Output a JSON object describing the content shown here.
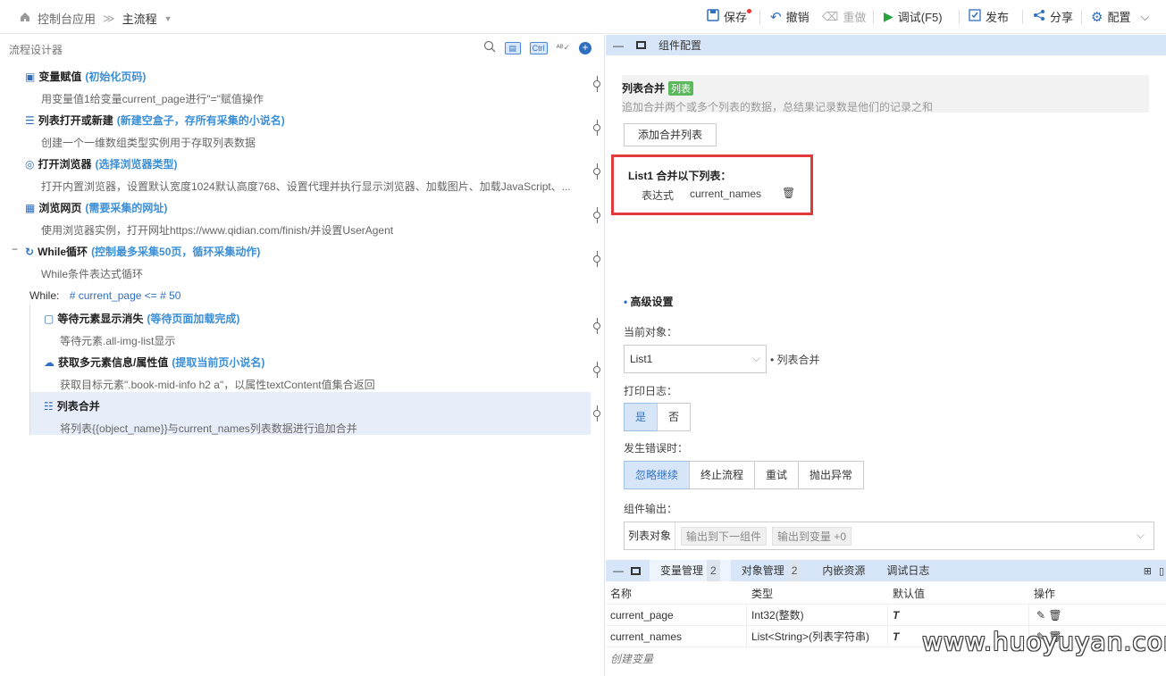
{
  "breadcrumb": {
    "app": "控制台应用",
    "flow": "主流程"
  },
  "toolbar": {
    "save": "保存",
    "undo": "撤销",
    "redo": "重做",
    "debug": "调试(F5)",
    "publish": "发布",
    "share": "分享",
    "config": "配置"
  },
  "left": {
    "title": "流程设计器",
    "ctrl": "Ctrl",
    "nodes": [
      {
        "title": "变量赋值",
        "sub": "(初始化页码)",
        "desc": "用变量值1给变量current_page进行\"=\"赋值操作"
      },
      {
        "title": "列表打开或新建",
        "sub": "(新建空盒子，存所有采集的小说名)",
        "desc": "创建一个一维数组类型实例用于存取列表数据"
      },
      {
        "title": "打开浏览器",
        "sub": "(选择浏览器类型)",
        "desc": "打开内置浏览器，设置默认宽度1024默认高度768、设置代理并执行显示浏览器、加载图片、加载JavaScript、..."
      },
      {
        "title": "浏览网页",
        "sub": "(需要采集的网址)",
        "desc": "使用浏览器实例，打开网址https://www.qidian.com/finish/并设置UserAgent"
      },
      {
        "title": "While循环",
        "sub": " (控制最多采集50页，循环采集动作)",
        "desc": "While条件表达式循环"
      }
    ],
    "while_cond_label": "While:",
    "while_cond": "# current_page <= # 50",
    "children": [
      {
        "title": "等待元素显示消失",
        "sub": "(等待页面加载完成)",
        "desc": "等待元素.all-img-list显示"
      },
      {
        "title": "获取多元素信息/属性值",
        "sub": "(提取当前页小说名)",
        "desc": "获取目标元素\".book-mid-info h2 a\"，以属性textContent值集合返回"
      },
      {
        "title": "列表合并",
        "sub": "",
        "desc": "将列表{{object_name}}与current_names列表数据进行追加合并"
      }
    ]
  },
  "right": {
    "header": "组件配置",
    "comp_title": "列表合并",
    "comp_tag": "列表",
    "comp_desc": "追加合并两个或多个列表的数据，总结果记录数是他们的记录之和",
    "add_btn": "添加合并列表",
    "merge_title": "List1 合并以下列表：",
    "expr_label": "表达式",
    "expr_value": "current_names",
    "adv": "高级设置",
    "cur_obj_label": "当前对象：",
    "cur_obj_value": "List1",
    "cur_obj_hint": "列表合并",
    "log_label": "打印日志：",
    "log_yes": "是",
    "log_no": "否",
    "err_label": "发生错误时：",
    "err_opts": [
      "忽略继续",
      "终止流程",
      "重试",
      "抛出异常"
    ],
    "out_label": "组件输出：",
    "out_key": "列表对象",
    "out_tag1": "输出到下一组件",
    "out_tag2": "输出到变量 +0"
  },
  "bottom": {
    "tabs": [
      {
        "label": "变量管理",
        "count": "2"
      },
      {
        "label": "对象管理",
        "count": "2"
      },
      {
        "label": "内嵌资源",
        "count": ""
      },
      {
        "label": "调试日志",
        "count": ""
      }
    ],
    "cols": [
      "名称",
      "类型",
      "默认值",
      "操作"
    ],
    "rows": [
      {
        "name": "current_page",
        "type": "Int32(整数)",
        "def": "T"
      },
      {
        "name": "current_names",
        "type": "List<String>(列表字符串)",
        "def": "T"
      }
    ],
    "create": "创建变量"
  },
  "watermark": "www.huoyuyan.com"
}
